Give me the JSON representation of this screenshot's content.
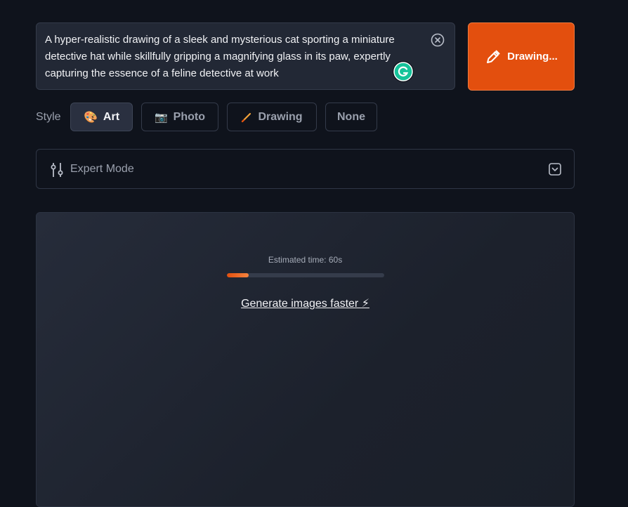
{
  "prompt": {
    "text": "A hyper-realistic drawing of a sleek and mysterious cat sporting a miniature detective hat while skillfully gripping a magnifying glass in its paw, expertly capturing the essence of a feline detective at work"
  },
  "draw_button": {
    "label": "Drawing..."
  },
  "style": {
    "label": "Style",
    "options": [
      {
        "label": "Art",
        "icon": "palette-icon",
        "active": true
      },
      {
        "label": "Photo",
        "icon": "camera-icon",
        "active": false
      },
      {
        "label": "Drawing",
        "icon": "pencil-icon",
        "active": false
      },
      {
        "label": "None",
        "icon": "",
        "active": false
      }
    ]
  },
  "expert_mode": {
    "label": "Expert Mode"
  },
  "generation": {
    "eta_text": "Estimated time: 60s",
    "progress_fraction": 0.14,
    "faster_link": "Generate images faster ⚡"
  },
  "colors": {
    "accent": "#e34f0e",
    "background": "#0f131c",
    "panel": "#222835"
  }
}
